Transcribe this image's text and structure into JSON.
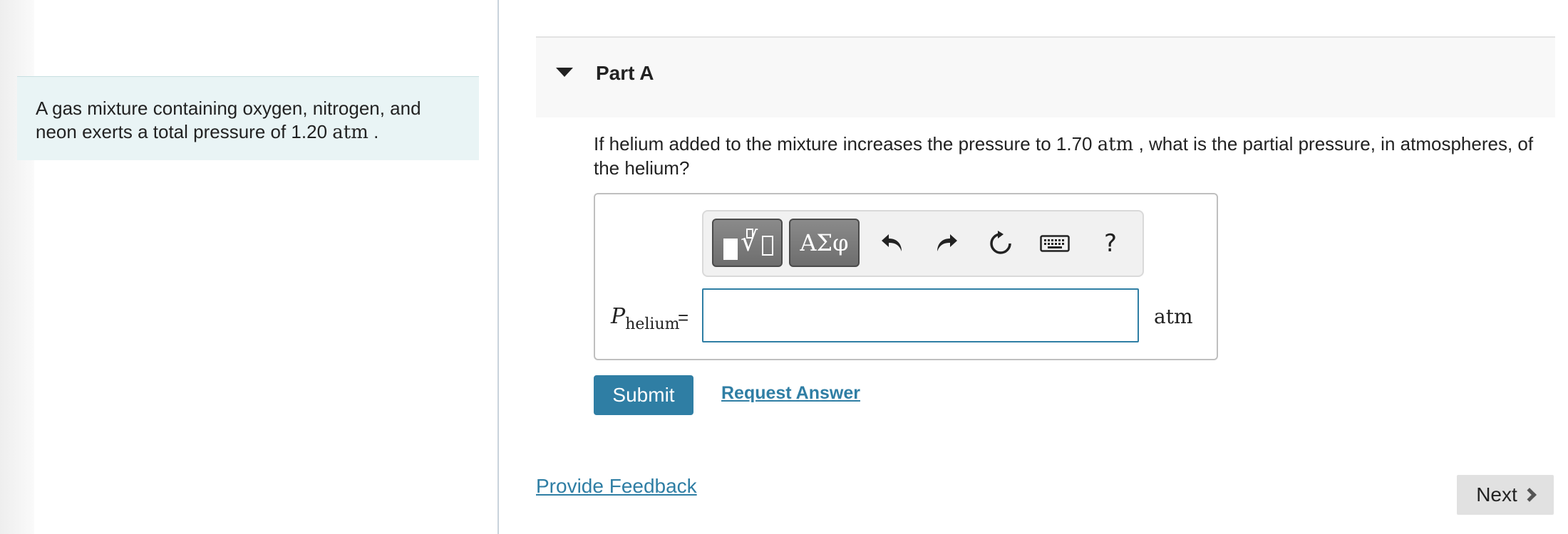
{
  "context": {
    "text": "A gas mixture containing oxygen, nitrogen, and neon exerts a total pressure of 1.20",
    "unit": "atm",
    "end": "."
  },
  "part": {
    "title": "Part A",
    "question_pre": "If helium added to the mixture increases the pressure to 1.70",
    "question_unit": "atm",
    "question_post": ", what is the partial pressure, in atmospheres, of the helium?"
  },
  "toolbar": {
    "greek_label": "ΑΣφ",
    "help_label": "?",
    "icons": [
      "templates-icon",
      "greek-letters-icon",
      "undo-icon",
      "redo-icon",
      "reset-icon",
      "keyboard-icon",
      "help-icon"
    ]
  },
  "answer": {
    "variable": "P",
    "subscript": "helium",
    "equals": "=",
    "value": "",
    "unit": "atm"
  },
  "actions": {
    "submit_label": "Submit",
    "request_label": "Request Answer",
    "feedback_label": "Provide Feedback",
    "next_label": "Next"
  },
  "colors": {
    "accent": "#2f7ea4",
    "context_bg": "#e9f4f5"
  }
}
